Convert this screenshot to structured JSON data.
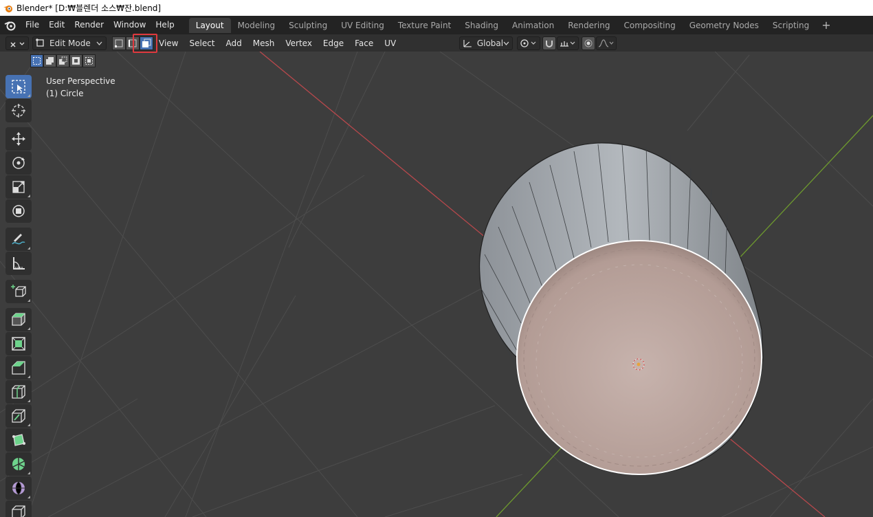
{
  "window": {
    "title": "Blender* [D:₩블렌더 소스₩잔.blend]"
  },
  "menubar": {
    "items": [
      "File",
      "Edit",
      "Render",
      "Window",
      "Help"
    ]
  },
  "workspaces": {
    "tabs": [
      "Layout",
      "Modeling",
      "Sculpting",
      "UV Editing",
      "Texture Paint",
      "Shading",
      "Animation",
      "Rendering",
      "Compositing",
      "Geometry Nodes",
      "Scripting"
    ],
    "active": "Layout",
    "add_label": "+"
  },
  "header": {
    "mode": "Edit Mode",
    "menus": [
      "View",
      "Select",
      "Add",
      "Mesh",
      "Vertex",
      "Edge",
      "Face",
      "UV"
    ],
    "transform_orientation": "Global",
    "select_mode_active": "face"
  },
  "viewport": {
    "perspective_label": "User Perspective",
    "object_label": "(1) Circle"
  },
  "toolbar": {
    "tools": [
      {
        "name": "select-box-tool",
        "icon": "select-box-icon",
        "active": true
      },
      {
        "name": "cursor-tool",
        "icon": "cursor-icon"
      },
      {
        "name": "move-tool",
        "icon": "move-icon"
      },
      {
        "name": "rotate-tool",
        "icon": "rotate-icon"
      },
      {
        "name": "scale-tool",
        "icon": "scale-icon"
      },
      {
        "name": "transform-tool",
        "icon": "transform-icon"
      },
      {
        "name": "annotate-tool",
        "icon": "annotate-icon"
      },
      {
        "name": "measure-tool",
        "icon": "measure-icon"
      },
      {
        "name": "add-cube-tool",
        "icon": "add-cube-icon"
      },
      {
        "name": "extrude-tool",
        "icon": "extrude-icon"
      },
      {
        "name": "inset-tool",
        "icon": "inset-icon"
      },
      {
        "name": "bevel-tool",
        "icon": "bevel-icon"
      },
      {
        "name": "loop-cut-tool",
        "icon": "loop-cut-icon"
      },
      {
        "name": "knife-tool",
        "icon": "knife-icon"
      },
      {
        "name": "poly-build-tool",
        "icon": "poly-build-icon"
      },
      {
        "name": "spin-tool",
        "icon": "spin-icon"
      },
      {
        "name": "smooth-tool",
        "icon": "smooth-icon"
      },
      {
        "name": "edge-slide-tool",
        "icon": "edge-slide-icon"
      }
    ]
  },
  "colors": {
    "x_axis": "#b8484c",
    "y_axis": "#6e9a2e",
    "accent": "#4772b3",
    "highlight_box": "#e0393e",
    "selected_face": "#b9a39c",
    "mesh_body": "#9aa0a6"
  }
}
